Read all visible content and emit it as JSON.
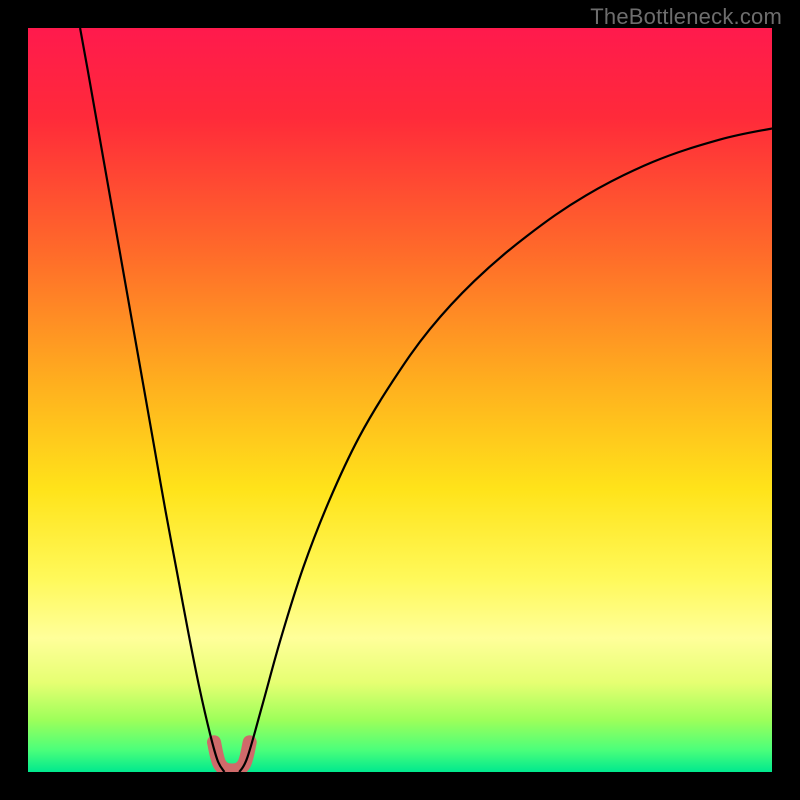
{
  "attribution": "TheBottleneck.com",
  "chart_data": {
    "type": "line",
    "title": "",
    "xlabel": "",
    "ylabel": "",
    "xlim": [
      0,
      100
    ],
    "ylim": [
      0,
      100
    ],
    "grid": false,
    "legend": false,
    "background_gradient": {
      "stops": [
        {
          "offset": 0.0,
          "color": "#ff1a4d"
        },
        {
          "offset": 0.12,
          "color": "#ff2a3a"
        },
        {
          "offset": 0.3,
          "color": "#ff6a2a"
        },
        {
          "offset": 0.48,
          "color": "#ffb01e"
        },
        {
          "offset": 0.62,
          "color": "#ffe31a"
        },
        {
          "offset": 0.74,
          "color": "#fff95a"
        },
        {
          "offset": 0.82,
          "color": "#ffff9a"
        },
        {
          "offset": 0.88,
          "color": "#e6ff72"
        },
        {
          "offset": 0.93,
          "color": "#9dff5a"
        },
        {
          "offset": 0.97,
          "color": "#4cff7a"
        },
        {
          "offset": 1.0,
          "color": "#00e98e"
        }
      ]
    },
    "series": [
      {
        "name": "left-descent",
        "stroke": "#000000",
        "stroke_width": 2.2,
        "data": [
          {
            "x": 7.0,
            "y": 100.0
          },
          {
            "x": 8.0,
            "y": 94.5
          },
          {
            "x": 9.5,
            "y": 86.0
          },
          {
            "x": 11.0,
            "y": 77.5
          },
          {
            "x": 12.5,
            "y": 69.0
          },
          {
            "x": 14.0,
            "y": 60.5
          },
          {
            "x": 15.5,
            "y": 52.0
          },
          {
            "x": 17.0,
            "y": 43.5
          },
          {
            "x": 18.5,
            "y": 35.0
          },
          {
            "x": 20.0,
            "y": 27.0
          },
          {
            "x": 21.5,
            "y": 19.0
          },
          {
            "x": 23.0,
            "y": 11.5
          },
          {
            "x": 24.5,
            "y": 5.0
          },
          {
            "x": 25.5,
            "y": 1.5
          },
          {
            "x": 26.4,
            "y": 0.0
          }
        ]
      },
      {
        "name": "right-ascent",
        "stroke": "#000000",
        "stroke_width": 2.2,
        "data": [
          {
            "x": 28.4,
            "y": 0.0
          },
          {
            "x": 29.5,
            "y": 2.0
          },
          {
            "x": 31.5,
            "y": 9.0
          },
          {
            "x": 34.0,
            "y": 18.0
          },
          {
            "x": 37.0,
            "y": 27.5
          },
          {
            "x": 40.5,
            "y": 36.5
          },
          {
            "x": 44.5,
            "y": 45.0
          },
          {
            "x": 49.0,
            "y": 52.5
          },
          {
            "x": 54.0,
            "y": 59.5
          },
          {
            "x": 60.0,
            "y": 66.0
          },
          {
            "x": 67.0,
            "y": 72.0
          },
          {
            "x": 75.0,
            "y": 77.5
          },
          {
            "x": 84.0,
            "y": 82.0
          },
          {
            "x": 93.0,
            "y": 85.0
          },
          {
            "x": 100.0,
            "y": 86.5
          }
        ]
      },
      {
        "name": "valley-marker",
        "stroke": "#cf6a6a",
        "stroke_width": 14,
        "linecap": "round",
        "data": [
          {
            "x": 25.0,
            "y": 4.0
          },
          {
            "x": 25.8,
            "y": 1.0
          },
          {
            "x": 27.4,
            "y": 0.2
          },
          {
            "x": 29.0,
            "y": 1.0
          },
          {
            "x": 29.8,
            "y": 4.0
          }
        ]
      }
    ]
  }
}
